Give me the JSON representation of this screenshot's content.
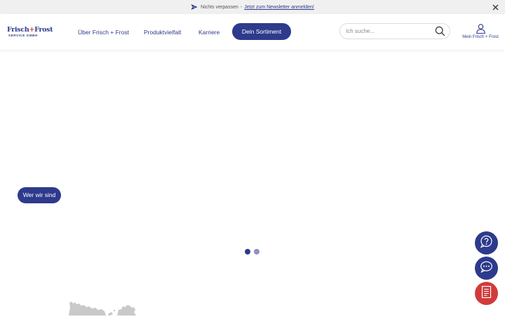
{
  "topbar": {
    "prefix": "Nichts verpassen",
    "separator": "-",
    "link_label": "Jetzt zum Newsletter anmelden!"
  },
  "logo": {
    "line1_a": "Frisch",
    "plus": "+",
    "line1_b": "Frost",
    "line2": "SERVICE GMBH"
  },
  "nav": {
    "items": [
      "Über Frisch + Frost",
      "Produktvielfalt",
      "Karriere"
    ],
    "cta": "Dein Sortiment"
  },
  "search": {
    "placeholder": "Ich suche..."
  },
  "account": {
    "label": "Mein Frisch + Frost"
  },
  "hero": {
    "button_label": "Wer wir sind",
    "carousel": {
      "slides": 2,
      "active_index": 0
    }
  },
  "side_actions": [
    "help-icon",
    "chat-icon",
    "catalog-icon"
  ],
  "colors": {
    "brand_blue": "#2e3a8c",
    "brand_red": "#d23a3a",
    "dot_inactive": "#8c92c4",
    "topbar_bg": "#f0f0f0"
  }
}
